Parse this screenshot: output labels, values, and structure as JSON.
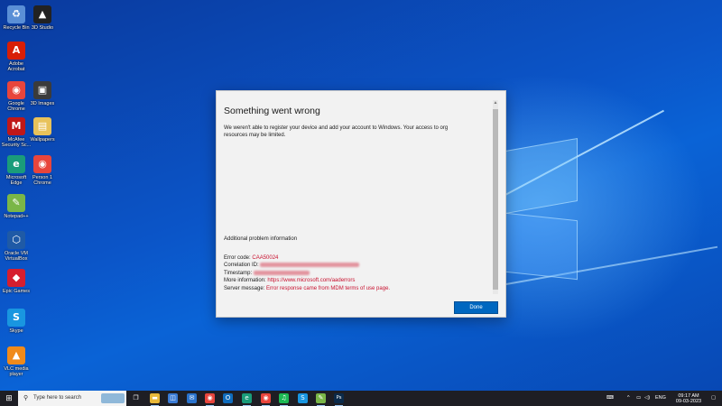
{
  "desktop": {
    "icons": [
      {
        "label": "Recycle Bin",
        "icon": "recycle-bin-icon",
        "color": "#5a8fd6",
        "glyph": "♻"
      },
      {
        "label": "3D Studio",
        "icon": "app-icon",
        "color": "#222222",
        "glyph": "▲"
      },
      {
        "label": "Adobe Acrobat",
        "icon": "acrobat-icon",
        "color": "#d81e06",
        "glyph": "A"
      },
      {
        "label": "Google Chrome",
        "icon": "chrome-icon",
        "color": "#e8453c",
        "glyph": "◉"
      },
      {
        "label": "3D Images",
        "icon": "app-icon",
        "color": "#3b3b3b",
        "glyph": "▣"
      },
      {
        "label": "McAfee Security Sc...",
        "icon": "mcafee-icon",
        "color": "#c01818",
        "glyph": "M"
      },
      {
        "label": "Wallpapers",
        "icon": "folder-icon",
        "color": "#e8c25a",
        "glyph": "▤"
      },
      {
        "label": "Microsoft Edge",
        "icon": "edge-icon",
        "color": "#1a9c7a",
        "glyph": "e"
      },
      {
        "label": "Person 1 Chrome",
        "icon": "chrome-icon",
        "color": "#e8453c",
        "glyph": "◉"
      },
      {
        "label": "Notepad++",
        "icon": "notepad-plus-icon",
        "color": "#7ab648",
        "glyph": "✎"
      },
      {
        "label": "Oracle VM VirtualBox",
        "icon": "virtualbox-icon",
        "color": "#1f5aa6",
        "glyph": "⬡"
      },
      {
        "label": "Epic Games",
        "icon": "app-icon",
        "color": "#d61e2e",
        "glyph": "◆"
      },
      {
        "label": "Skype",
        "icon": "skype-icon",
        "color": "#1996e0",
        "glyph": "S"
      },
      {
        "label": "VLC media player",
        "icon": "vlc-icon",
        "color": "#f08a1a",
        "glyph": "▲"
      }
    ]
  },
  "dialog": {
    "title": "Something went wrong",
    "description": "We weren't able to register your device and add your account to Windows. Your access to org resources may be limited.",
    "section_title": "Additional problem information",
    "error_code_label": "Error code:",
    "error_code_value": "CAA50024",
    "correlation_label": "Correlation ID:",
    "timestamp_label": "Timestamp:",
    "more_info_label": "More information:",
    "more_info_link": "https://www.microsoft.com/aaderrors",
    "server_message_label": "Server message:",
    "server_message_value": "Error response came from MDM terms of use page.",
    "done_label": "Done",
    "scroll_up_glyph": "▲"
  },
  "taskbar": {
    "start_glyph": "⊞",
    "search_glyph": "⚲",
    "search_placeholder": "Type here to search",
    "pinned": [
      {
        "name": "task-view-icon",
        "color": "#1e1e24",
        "glyph": "❐"
      },
      {
        "name": "file-explorer-icon",
        "color": "#e8b83a",
        "glyph": "▬"
      },
      {
        "name": "store-icon",
        "color": "#3a7bd5",
        "glyph": "◫"
      },
      {
        "name": "mail-icon",
        "color": "#2a73cc",
        "glyph": "✉"
      },
      {
        "name": "chrome-icon",
        "color": "#e8453c",
        "glyph": "◉"
      },
      {
        "name": "outlook-icon",
        "color": "#0f6cbd",
        "glyph": "O"
      },
      {
        "name": "edge-icon",
        "color": "#1a9c7a",
        "glyph": "e"
      },
      {
        "name": "chrome-icon",
        "color": "#e8453c",
        "glyph": "◉"
      },
      {
        "name": "spotify-icon",
        "color": "#1db954",
        "glyph": "♫"
      },
      {
        "name": "skype-icon",
        "color": "#1996e0",
        "glyph": "S"
      },
      {
        "name": "notepad-plus-icon",
        "color": "#7ab648",
        "glyph": "✎"
      },
      {
        "name": "photoshop-icon",
        "color": "#0b2a4a",
        "glyph": "Ps"
      }
    ],
    "tray": {
      "language": "ENG",
      "time": "09:17 AM",
      "date": "09-03-2023",
      "chevron": "^",
      "notification_glyph": "▢"
    }
  },
  "colors": {
    "accent": "#0067c0",
    "error_text": "#c8102e",
    "taskbar_bg": "#1e1e24"
  }
}
